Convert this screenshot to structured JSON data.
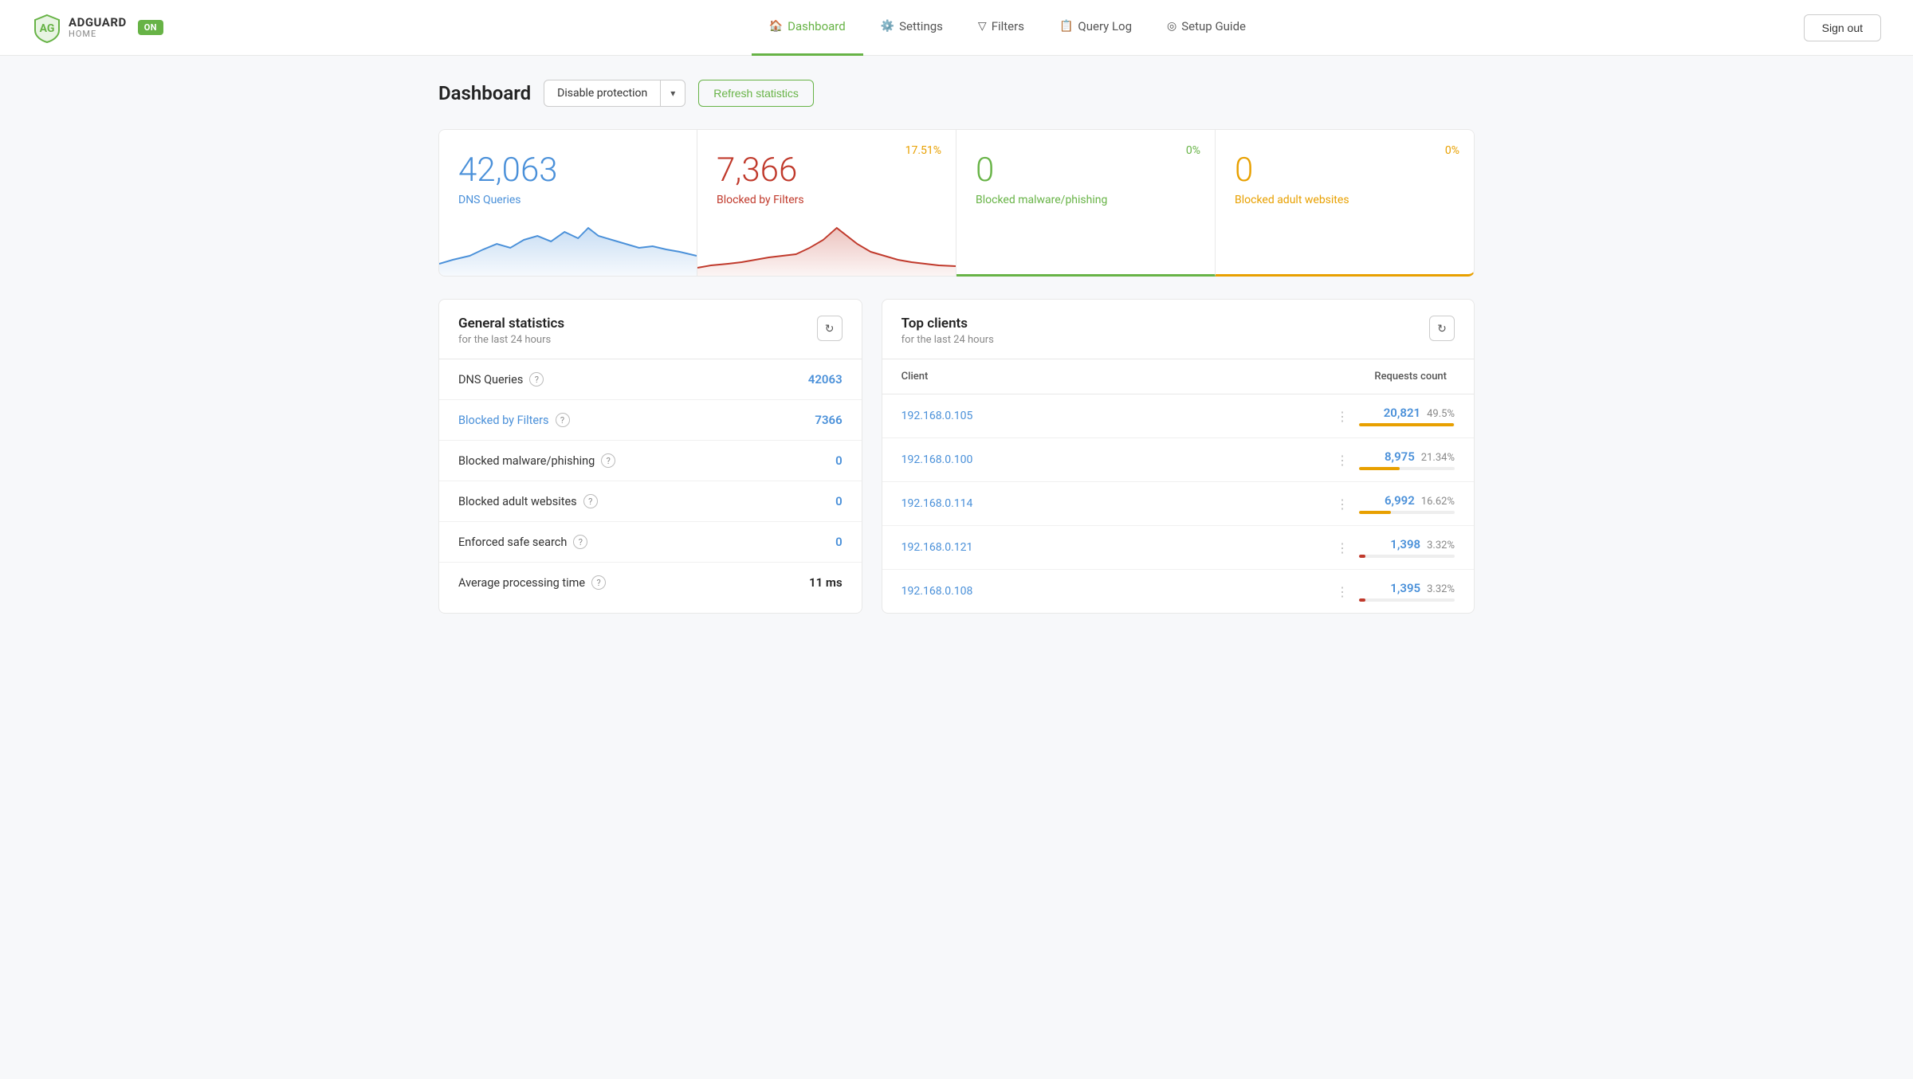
{
  "header": {
    "logo": {
      "brand": "ADGUARD",
      "product": "HOME",
      "status": "ON"
    },
    "nav": [
      {
        "id": "dashboard",
        "label": "Dashboard",
        "icon": "🏠",
        "active": true
      },
      {
        "id": "settings",
        "label": "Settings",
        "icon": "⚙️",
        "active": false
      },
      {
        "id": "filters",
        "label": "Filters",
        "icon": "🔽",
        "active": false
      },
      {
        "id": "query-log",
        "label": "Query Log",
        "icon": "📋",
        "active": false
      },
      {
        "id": "setup-guide",
        "label": "Setup Guide",
        "icon": "⊙",
        "active": false
      }
    ],
    "sign_out": "Sign out"
  },
  "page": {
    "title": "Dashboard",
    "disable_protection": "Disable protection",
    "refresh_statistics": "Refresh statistics"
  },
  "stat_cards": [
    {
      "id": "dns-queries",
      "number": "42,063",
      "label": "DNS Queries",
      "color": "blue",
      "percentage": null
    },
    {
      "id": "blocked-filters",
      "number": "7,366",
      "label": "Blocked by Filters",
      "color": "red",
      "percentage": "17.51%"
    },
    {
      "id": "blocked-malware",
      "number": "0",
      "label": "Blocked malware/phishing",
      "color": "green",
      "percentage": "0%"
    },
    {
      "id": "blocked-adult",
      "number": "0",
      "label": "Blocked adult websites",
      "color": "yellow",
      "percentage": "0%"
    }
  ],
  "general_stats": {
    "title": "General statistics",
    "subtitle": "for the last 24 hours",
    "rows": [
      {
        "label": "DNS Queries",
        "value": "42063",
        "color": "blue",
        "link": false
      },
      {
        "label": "Blocked by Filters",
        "value": "7366",
        "color": "blue",
        "link": true
      },
      {
        "label": "Blocked malware/phishing",
        "value": "0",
        "color": "blue",
        "link": false
      },
      {
        "label": "Blocked adult websites",
        "value": "0",
        "color": "blue",
        "link": false
      },
      {
        "label": "Enforced safe search",
        "value": "0",
        "color": "blue",
        "link": false
      },
      {
        "label": "Average processing time",
        "value": "11 ms",
        "color": "dark",
        "link": false
      }
    ]
  },
  "top_clients": {
    "title": "Top clients",
    "subtitle": "for the last 24 hours",
    "col_client": "Client",
    "col_requests": "Requests count",
    "clients": [
      {
        "ip": "192.168.0.105",
        "count": "20,821",
        "percent": "49.5%",
        "bar_pct": 49.5,
        "bar_color": "#e8a000"
      },
      {
        "ip": "192.168.0.100",
        "count": "8,975",
        "percent": "21.34%",
        "bar_pct": 21.34,
        "bar_color": "#e8a000"
      },
      {
        "ip": "192.168.0.114",
        "count": "6,992",
        "percent": "16.62%",
        "bar_pct": 16.62,
        "bar_color": "#e8a000"
      },
      {
        "ip": "192.168.0.121",
        "count": "1,398",
        "percent": "3.32%",
        "bar_pct": 3.32,
        "bar_color": "#c0392b"
      },
      {
        "ip": "192.168.0.108",
        "count": "1,395",
        "percent": "3.32%",
        "bar_pct": 3.32,
        "bar_color": "#c0392b"
      }
    ]
  }
}
